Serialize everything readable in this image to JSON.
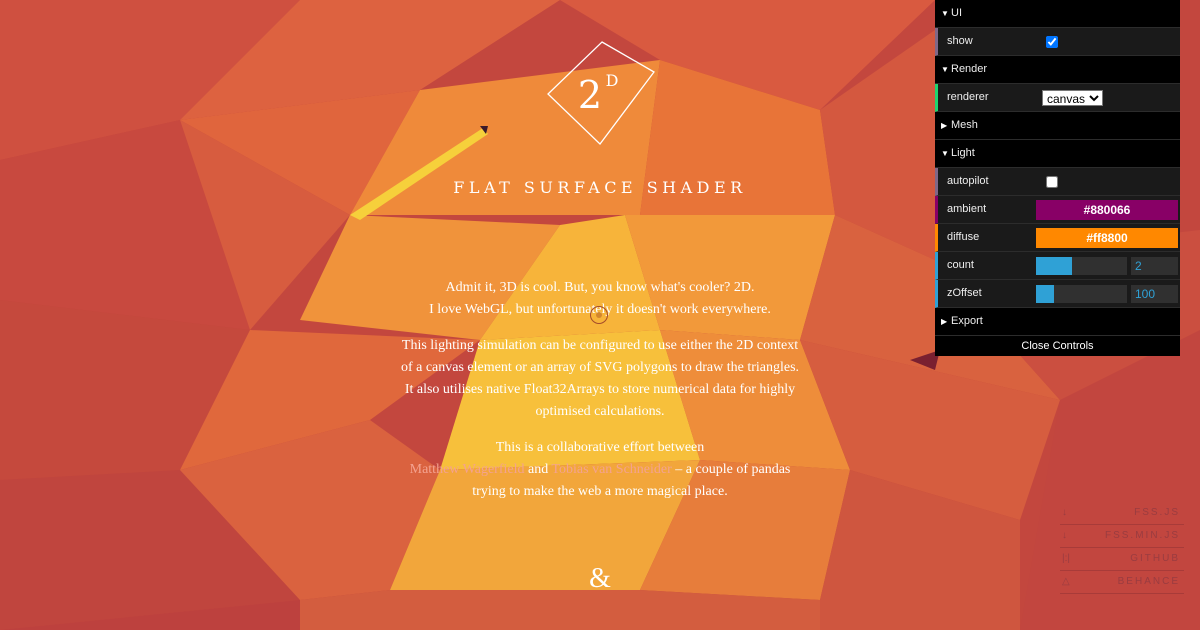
{
  "hero": {
    "logo_text": "2",
    "logo_sup": "D",
    "title": "FLAT SURFACE SHADER",
    "para1_line1": "Admit it, 3D is cool. But, you know what's cooler? 2D.",
    "para1_line2": "I love WebGL, but unfortunately it doesn't work everywhere.",
    "para2": "This lighting simulation can be configured to use either the 2D context of a canvas element or an array of SVG polygons to draw the triangles. It also utilises native Float32Arrays to store numerical data for highly optimised calculations.",
    "para3_prefix": "This is a collaborative effort between",
    "author1": "Matthew Wagerfield",
    "and_text": "and",
    "author2": "Tobias van Schneider",
    "para3_suffix": "– a couple of pandas trying to make the web a more magical place.",
    "ampersand": "&"
  },
  "gui": {
    "folders": {
      "ui": "UI",
      "render": "Render",
      "mesh": "Mesh",
      "light": "Light",
      "export": "Export"
    },
    "show_label": "show",
    "show_checked": true,
    "renderer_label": "renderer",
    "renderer_value": "canvas",
    "autopilot_label": "autopilot",
    "autopilot_checked": false,
    "ambient_label": "ambient",
    "ambient_value": "#880066",
    "diffuse_label": "diffuse",
    "diffuse_value": "#ff8800",
    "count_label": "count",
    "count_value": "2",
    "count_fill": 0.4,
    "zoffset_label": "zOffset",
    "zoffset_value": "100",
    "zoffset_fill": 0.2,
    "close_label": "Close Controls"
  },
  "links": [
    {
      "icon": "download-icon",
      "glyph": "↓",
      "label": "FSS.JS"
    },
    {
      "icon": "download-icon",
      "glyph": "↓",
      "label": "FSS.MIN.JS"
    },
    {
      "icon": "github-icon",
      "glyph": "|:|",
      "label": "GITHUB"
    },
    {
      "icon": "behance-icon",
      "glyph": "△",
      "label": "BEHANCE"
    }
  ],
  "colors": {
    "accent_blue": "#2fa1d6",
    "ambient": "#880066",
    "diffuse": "#ff8800"
  }
}
